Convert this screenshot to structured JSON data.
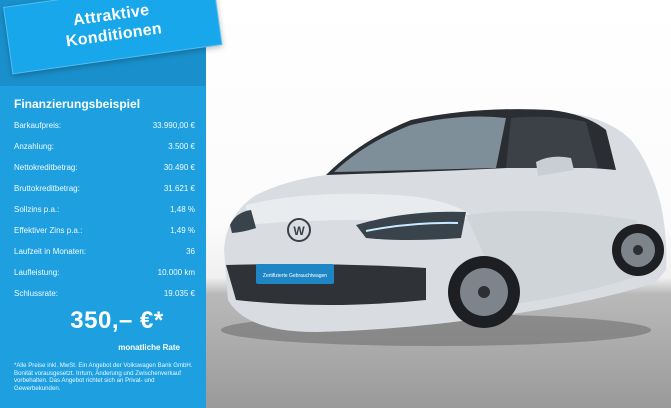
{
  "badge": {
    "line1": "Attraktive",
    "line2": "Konditionen"
  },
  "finance": {
    "title": "Finanzierungsbeispiel",
    "rows": [
      {
        "label": "Barkaufpreis:",
        "value": "33.990,00 €"
      },
      {
        "label": "Anzahlung:",
        "value": "3.500 €"
      },
      {
        "label": "Nettokreditbetrag:",
        "value": "30.490 €"
      },
      {
        "label": "Bruttokreditbetrag:",
        "value": "31.621 €"
      },
      {
        "label": "Sollzins p.a.:",
        "value": "1,48 %"
      },
      {
        "label": "Effektiver Zins p.a.:",
        "value": "1,49 %"
      },
      {
        "label": "Laufzeit in Monaten:",
        "value": "36"
      },
      {
        "label": "Laufleistung:",
        "value": "10.000 km"
      },
      {
        "label": "Schlussrate:",
        "value": "19.035 €"
      }
    ],
    "rate": "350,– €*",
    "rate_label": "monatliche Rate",
    "footnote": "*Alle Preise inkl. MwSt. Ein Angebot der Volkswagen Bank GmbH. Bonität vorausgesetzt. Irrtum, Änderung und Zwischenverkauf vorbehalten. Das Angebot richtet sich an Privat- und Gewerbekunden."
  },
  "plate": {
    "text": "Zertifizierte Gebrauchtwagen"
  },
  "colors": {
    "panel": "#1ea0e0",
    "badge": "#18a7eb"
  }
}
